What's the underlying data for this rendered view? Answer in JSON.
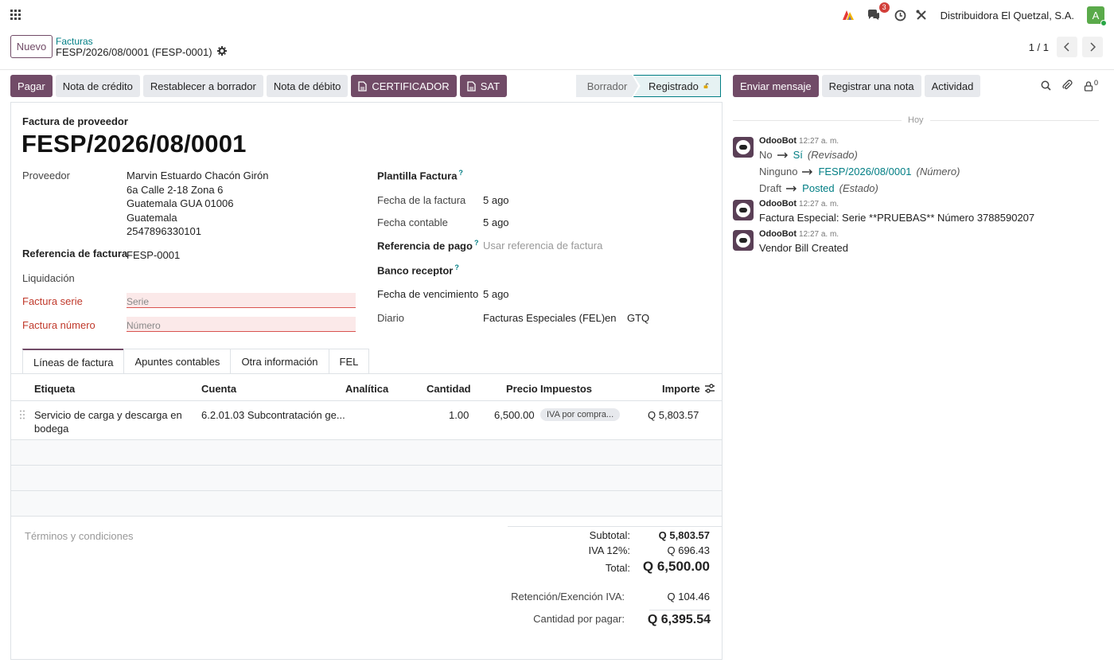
{
  "navbar": {
    "company": "Distribuidora El Quetzal, S.A.",
    "messages_count": "3",
    "avatar_letter": "A"
  },
  "control_panel": {
    "new_label": "Nuevo",
    "breadcrumb_parent": "Facturas",
    "breadcrumb_current": "FESP/2026/08/0001 (FESP-0001)",
    "pager": "1 / 1"
  },
  "actions": {
    "pagar": "Pagar",
    "nota_credito": "Nota de crédito",
    "restablecer": "Restablecer a borrador",
    "nota_debito": "Nota de débito",
    "certificador": "CERTIFICADOR",
    "sat": "SAT"
  },
  "status": {
    "draft": "Borrador",
    "posted": "Registrado"
  },
  "chatter_actions": {
    "send": "Enviar mensaje",
    "note": "Registrar una nota",
    "activity": "Actividad",
    "followers": "0"
  },
  "form": {
    "doc_type": "Factura de proveedor",
    "doc_name": "FESP/2026/08/0001",
    "proveedor_label": "Proveedor",
    "proveedor_name": "Marvin Estuardo Chacón Girón",
    "proveedor_addr1": "6a Calle 2-18 Zona 6",
    "proveedor_addr2": "Guatemala GUA 01006",
    "proveedor_addr3": "Guatemala",
    "proveedor_addr4": "2547896330101",
    "ref_label": "Referencia de factura",
    "ref_value": "FESP-0001",
    "liquidacion_label": "Liquidación",
    "serie_label": "Factura serie",
    "serie_placeholder": "Serie",
    "numero_label": "Factura número",
    "numero_placeholder": "Número",
    "plantilla_label": "Plantilla Factura",
    "fecha_factura_label": "Fecha de la factura",
    "fecha_factura": "5 ago",
    "fecha_contable_label": "Fecha contable",
    "fecha_contable": "5 ago",
    "ref_pago_label": "Referencia de pago",
    "ref_pago_placeholder": "Usar referencia de factura",
    "banco_label": "Banco receptor",
    "vencimiento_label": "Fecha de vencimiento",
    "vencimiento": "5 ago",
    "diario_label": "Diario",
    "diario": "Facturas Especiales (FEL)",
    "diario_en": "en",
    "moneda": "GTQ",
    "help_mark": "?"
  },
  "tabs": [
    "Líneas de factura",
    "Apuntes contables",
    "Otra información",
    "FEL"
  ],
  "table": {
    "headers": {
      "etiqueta": "Etiqueta",
      "cuenta": "Cuenta",
      "analitica": "Analítica",
      "cantidad": "Cantidad",
      "precio": "Precio",
      "impuestos": "Impuestos",
      "importe": "Importe"
    },
    "rows": [
      {
        "etiqueta_l1": "Servicio de carga y descarga en",
        "etiqueta_l2": "bodega",
        "cuenta": "6.2.01.03 Subcontratación ge...",
        "cantidad": "1.00",
        "precio": "6,500.00",
        "impuesto": "IVA por compra...",
        "importe": "Q 5,803.57"
      }
    ]
  },
  "totals": {
    "terms_placeholder": "Términos y condiciones",
    "subtotal_label": "Subtotal:",
    "subtotal": "Q 5,803.57",
    "iva_label": "IVA 12%:",
    "iva": "Q 696.43",
    "total_label": "Total:",
    "total": "Q 6,500.00",
    "retencion_label": "Retención/Exención IVA:",
    "retencion": "Q 104.46",
    "por_pagar_label": "Cantidad por pagar:",
    "por_pagar": "Q 6,395.54"
  },
  "chatter": {
    "date_sep": "Hoy",
    "messages": [
      {
        "author": "OdooBot",
        "time": "12:27 a. m.",
        "changes": [
          {
            "old": "No",
            "new": "Sí",
            "field": "(Revisado)"
          },
          {
            "old": "Ninguno",
            "new": "FESP/2026/08/0001",
            "field": "(Número)"
          },
          {
            "old": "Draft",
            "new": "Posted",
            "field": "(Estado)"
          }
        ]
      },
      {
        "author": "OdooBot",
        "time": "12:27 a. m.",
        "body": "Factura Especial: Serie **PRUEBAS** Número 3788590207"
      },
      {
        "author": "OdooBot",
        "time": "12:27 a. m.",
        "body": "Vendor Bill Created"
      }
    ]
  }
}
